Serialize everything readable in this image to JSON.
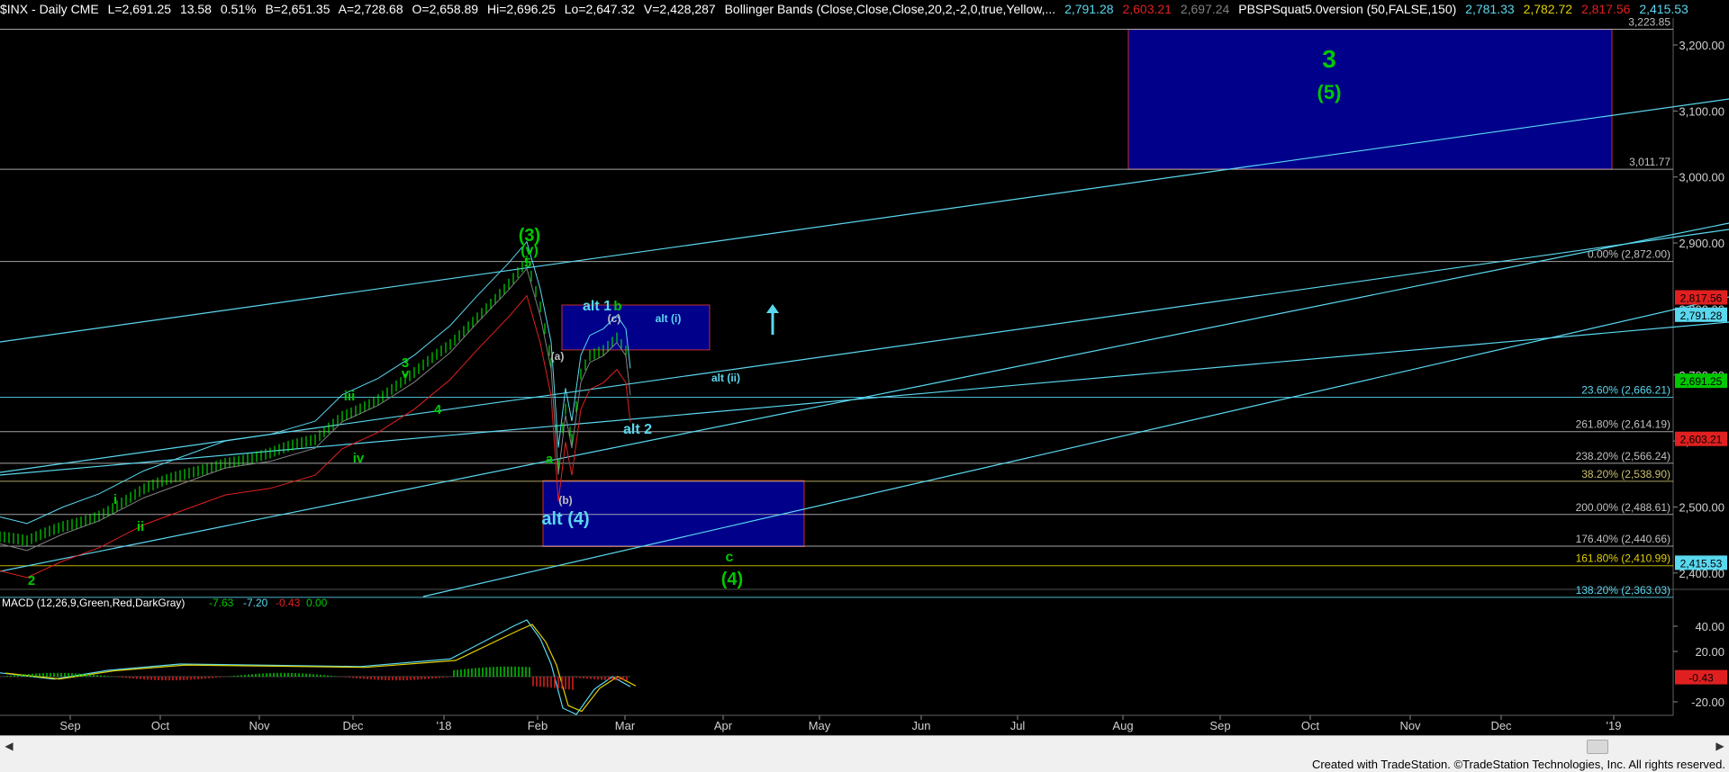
{
  "header": {
    "symbol": "$INX - Daily CME",
    "last": "L=2,691.25",
    "change": "13.58",
    "pct": "0.51%",
    "bid": "B=2,651.35",
    "ask": "A=2,728.68",
    "open": "O=2,658.89",
    "high": "Hi=2,696.25",
    "low": "Lo=2,647.32",
    "volume": "V=2,428,287",
    "bb_label": "Bollinger Bands (Close,Close,Close,20,2,-2,0,true,Yellow,...",
    "bb_v1": "2,791.28",
    "bb_v2": "2,603.21",
    "bb_v3": "2,697.24",
    "pbs_label": "PBSPSquat5.0version (50,FALSE,150)",
    "pbs_v1": "2,781.33",
    "pbs_v2": "2,782.72",
    "pbs_v3": "2,817.56",
    "pbs_v4": "2,415.53"
  },
  "colors": {
    "green": "#00c800",
    "cyan": "#5ad8f0",
    "red": "#e02020",
    "yellow": "#e0d000",
    "box": "#00008b",
    "bright_green": "#00ff00"
  },
  "price_axis": {
    "ticks": [
      "3,200.00",
      "3,100.00",
      "3,000.00",
      "2,900.00",
      "2,800.00",
      "2,700.00",
      "2,600.00",
      "2,500.00",
      "2,400.00"
    ],
    "tags": [
      {
        "text": "2,817.56",
        "color": "#e02020",
        "y": 2817.56
      },
      {
        "text": "2,791.28",
        "color": "#5ad8f0",
        "y": 2791.28
      },
      {
        "text": "2,691.25",
        "color": "#00c800",
        "y": 2691.25
      },
      {
        "text": "2,603.21",
        "color": "#e02020",
        "y": 2603.21
      },
      {
        "text": "2,415.53",
        "color": "#5ad8f0",
        "y": 2415.53
      }
    ]
  },
  "levels": [
    {
      "text": "3,223.85",
      "y": 3223.85,
      "color": "#c0c0c0"
    },
    {
      "text": "3,011.77",
      "y": 3011.77,
      "color": "#c0c0c0"
    },
    {
      "text": "0.00% (2,872.00)",
      "y": 2872.0,
      "color": "#c0c0c0"
    },
    {
      "text": "23.60% (2,666.21)",
      "y": 2666.21,
      "color": "#5ad8f0"
    },
    {
      "text": "261.80% (2,614.19)",
      "y": 2614.19,
      "color": "#c0c0c0"
    },
    {
      "text": "238.20% (2,566.24)",
      "y": 2566.24,
      "color": "#c0c0c0"
    },
    {
      "text": "38.20% (2,538.90)",
      "y": 2538.9,
      "color": "#c8c070"
    },
    {
      "text": "200.00% (2,488.61)",
      "y": 2488.61,
      "color": "#c0c0c0"
    },
    {
      "text": "176.40% (2,440.66)",
      "y": 2440.66,
      "color": "#c0c0c0"
    },
    {
      "text": "161.80% (2,410.99)",
      "y": 2410.99,
      "color": "#e0d000"
    },
    {
      "text": "138.20% (2,363.03)",
      "y": 2363.03,
      "color": "#5ad8f0"
    }
  ],
  "wave_labels": [
    {
      "text": "3",
      "color": "#00c800",
      "size": 28
    },
    {
      "text": "(5)",
      "color": "#00c800",
      "size": 22
    },
    {
      "text": "(3)",
      "color": "#00c800",
      "size": 20
    },
    {
      "text": "(v)",
      "color": "#00c800",
      "size": 16
    },
    {
      "text": "5",
      "color": "#00c800",
      "size": 15
    },
    {
      "text": "alt 1",
      "color": "#5ad8f0",
      "size": 16
    },
    {
      "text": "b",
      "color": "#00c800",
      "size": 15
    },
    {
      "text": "(c)",
      "color": "#c0c0c0",
      "size": 12
    },
    {
      "text": "alt (i)",
      "color": "#5ad8f0",
      "size": 12
    },
    {
      "text": "(a)",
      "color": "#c0c0c0",
      "size": 12
    },
    {
      "text": "alt (ii)",
      "color": "#5ad8f0",
      "size": 12
    },
    {
      "text": "alt 2",
      "color": "#5ad8f0",
      "size": 16
    },
    {
      "text": "a",
      "color": "#00c800",
      "size": 15
    },
    {
      "text": "(b)",
      "color": "#c0c0c0",
      "size": 12
    },
    {
      "text": "alt (4)",
      "color": "#5ad8f0",
      "size": 20
    },
    {
      "text": "c",
      "color": "#00c800",
      "size": 16
    },
    {
      "text": "(4)",
      "color": "#00c800",
      "size": 20
    },
    {
      "text": "3",
      "color": "#00c800",
      "size": 15
    },
    {
      "text": "v",
      "color": "#00c800",
      "size": 15
    },
    {
      "text": "4",
      "color": "#00c800",
      "size": 15
    },
    {
      "text": "iii",
      "color": "#00c800",
      "size": 15
    },
    {
      "text": "iv",
      "color": "#00c800",
      "size": 15
    },
    {
      "text": "i",
      "color": "#00c800",
      "size": 15
    },
    {
      "text": "ii",
      "color": "#00c800",
      "size": 15
    },
    {
      "text": "2",
      "color": "#00c800",
      "size": 15
    }
  ],
  "macd": {
    "label": "MACD (12,26,9,Green,Red,DarkGray)",
    "v1": "-7.63",
    "v2": "-7.20",
    "v3": "-0.43",
    "v4": "0.00",
    "ticks": [
      "40.00",
      "20.00",
      "-20.00"
    ],
    "tag": "-0.43"
  },
  "time_axis": [
    "Sep",
    "Oct",
    "Nov",
    "Dec",
    "'18",
    "Feb",
    "Mar",
    "Apr",
    "May",
    "Jun",
    "Jul",
    "Aug",
    "Sep",
    "Oct",
    "Nov",
    "Dec",
    "'19"
  ],
  "footer": {
    "text": "Created with TradeStation. ©TradeStation Technologies, Inc. All rights reserved."
  },
  "scrollbar": {
    "left_arrow": "◀",
    "right_arrow": "▶"
  }
}
